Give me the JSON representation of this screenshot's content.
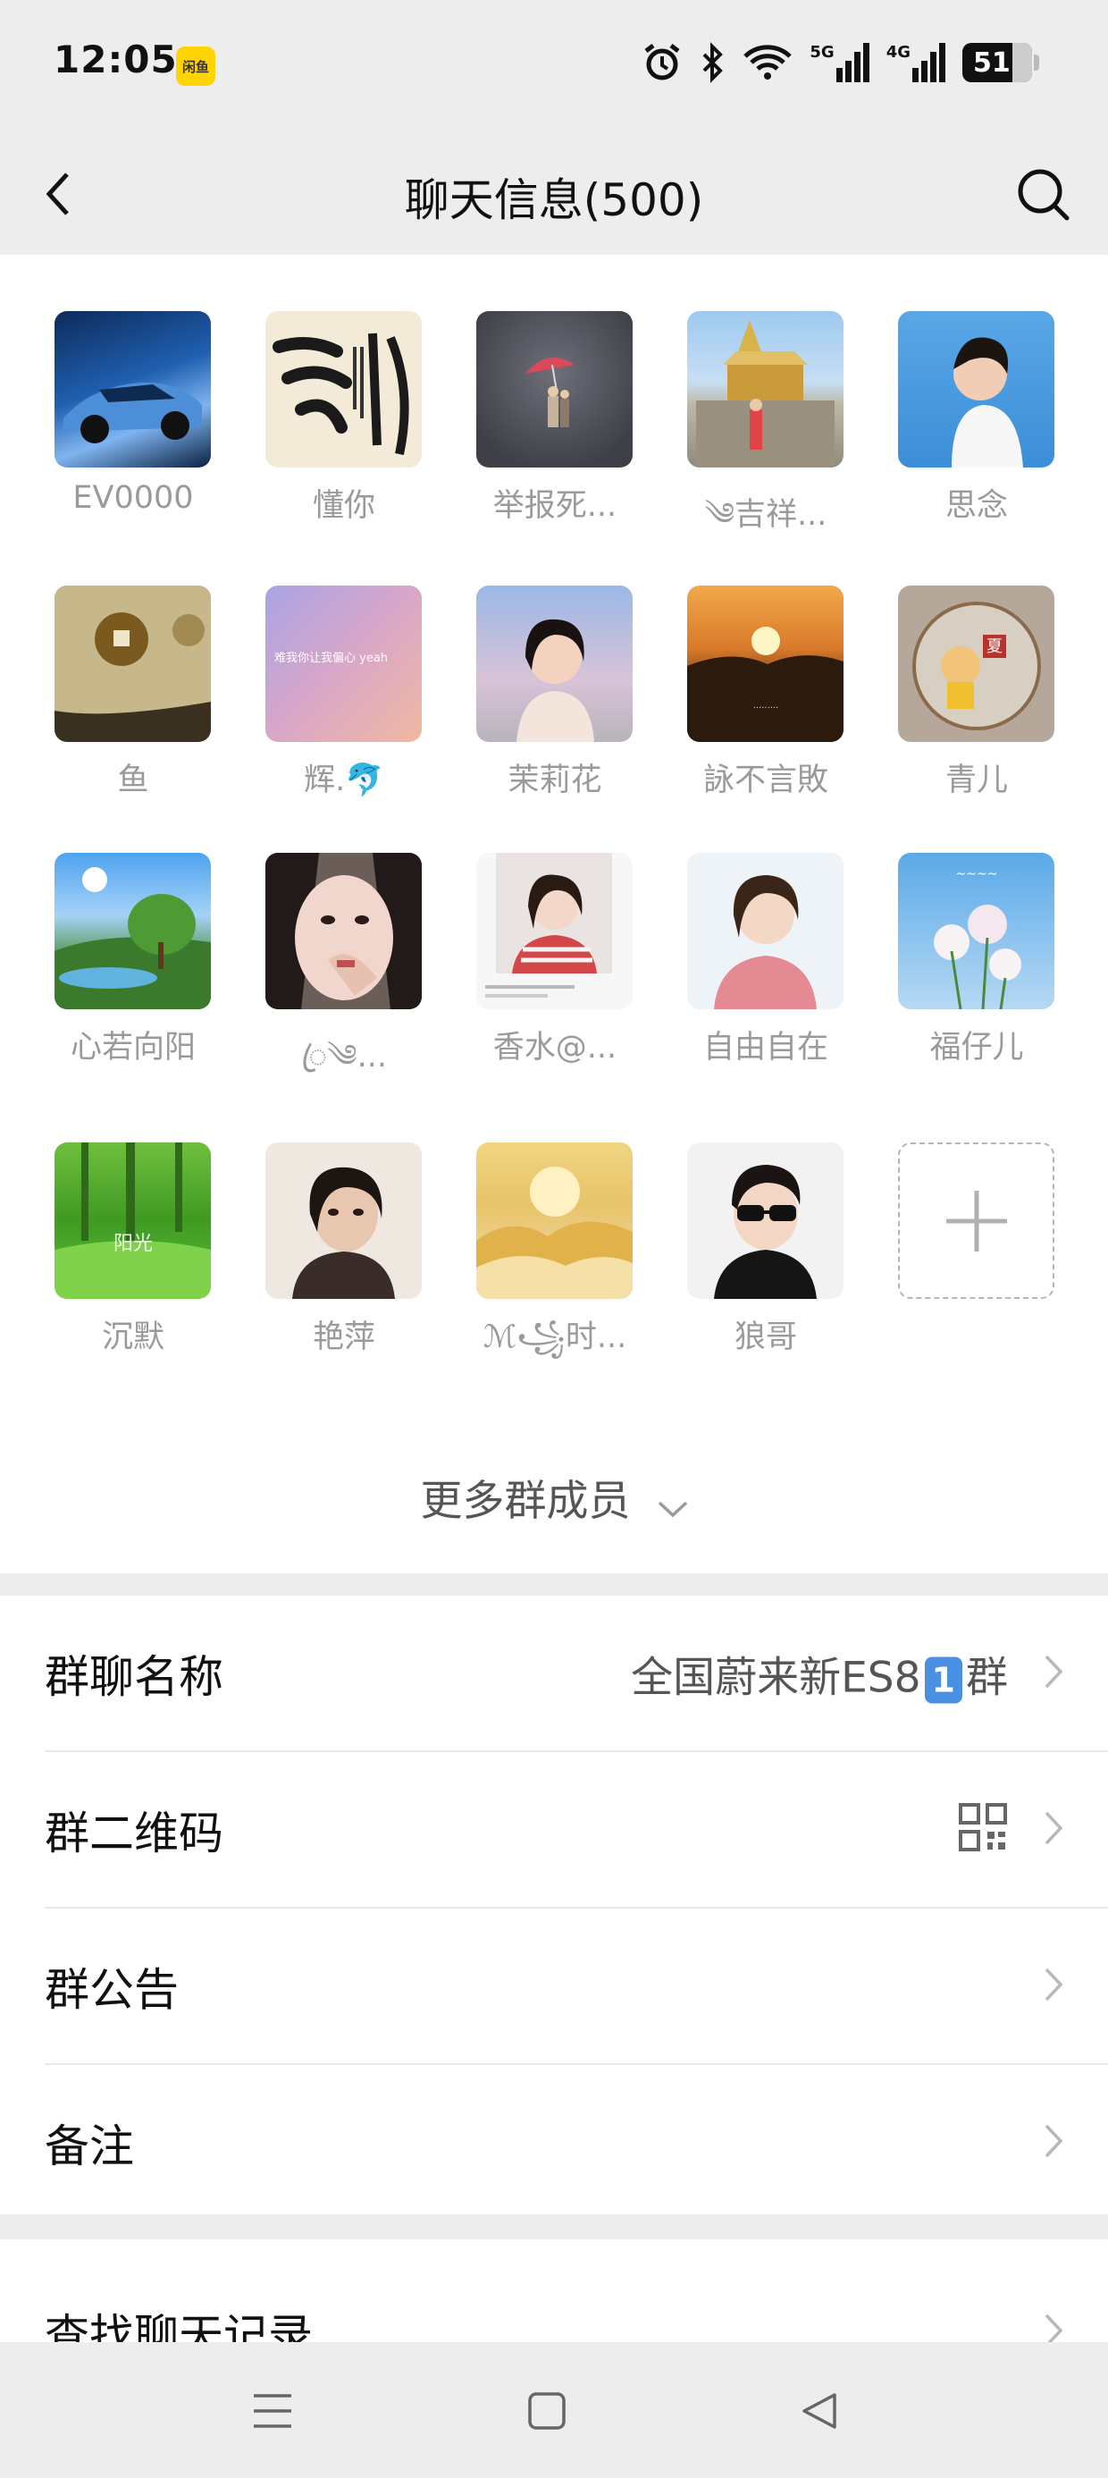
{
  "status_bar": {
    "time": "12:05",
    "app_badge": "闲鱼",
    "network_5g": "5G",
    "network_4g": "4G",
    "battery": "51"
  },
  "header": {
    "title": "聊天信息(500)"
  },
  "members": [
    {
      "name": "EV0000"
    },
    {
      "name": "懂你"
    },
    {
      "name": "举报死..."
    },
    {
      "name": "༄吉祥..."
    },
    {
      "name": "思念"
    },
    {
      "name": "鱼"
    },
    {
      "name": "辉.🐬"
    },
    {
      "name": "茉莉花"
    },
    {
      "name": "詠不言敗"
    },
    {
      "name": "青儿"
    },
    {
      "name": "心若向阳"
    },
    {
      "name": "ꦿ༄..."
    },
    {
      "name": "香水@..."
    },
    {
      "name": "自由自在"
    },
    {
      "name": "福仔儿"
    },
    {
      "name": "沉默"
    },
    {
      "name": "艳萍"
    },
    {
      "name": "ℳ꧁时..."
    },
    {
      "name": "狼哥"
    }
  ],
  "more_members": "更多群成员",
  "settings": {
    "group_name_label": "群聊名称",
    "group_name_prefix": "全国蔚来新ES8",
    "group_name_badge": "1",
    "group_name_suffix": "群",
    "qr_label": "群二维码",
    "notice_label": "群公告",
    "remark_label": "备注",
    "search_history_label": "查找聊天记录"
  }
}
